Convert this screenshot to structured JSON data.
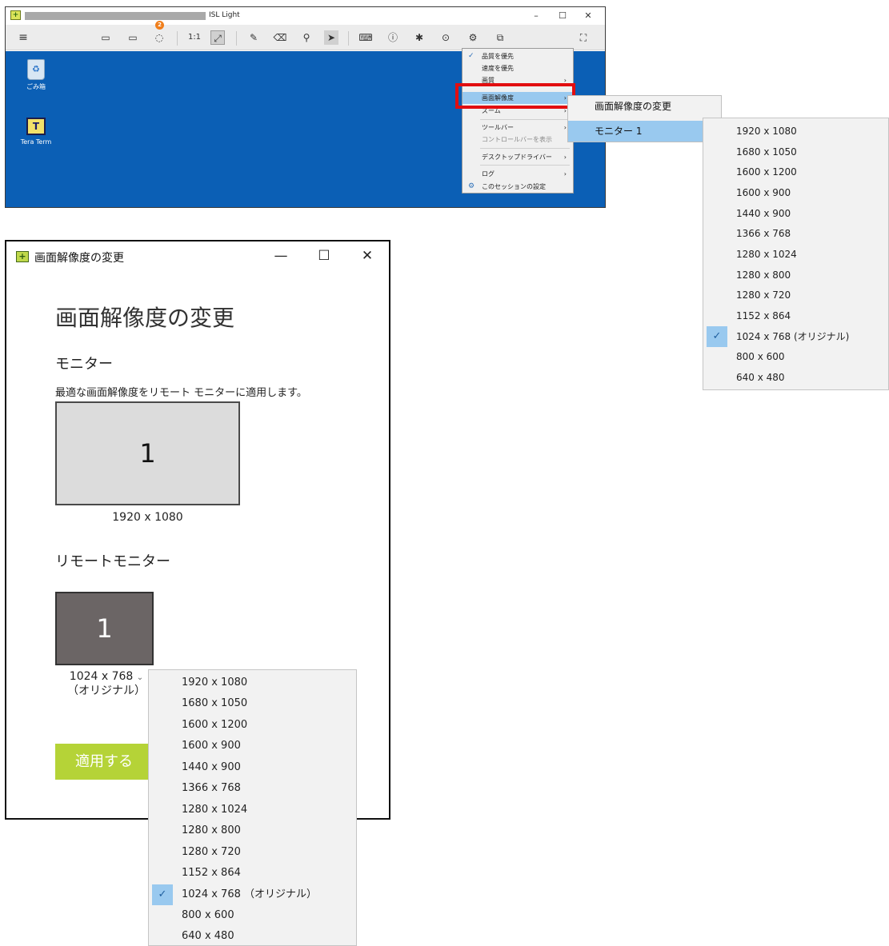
{
  "isl_window": {
    "title": "ISL Light",
    "chat_badge": "2",
    "toolbar": {
      "menu_icon": "≡",
      "monitor_icon": "▭",
      "folder_icon": "▭",
      "chat_icon": "◌",
      "one_to_one": "1:1",
      "fit_icon": "⤢",
      "pen_icon": "✎",
      "eraser_icon": "⌫",
      "pin_icon": "⚲",
      "pointer_icon": "➤",
      "keyboard_icon": "⌨",
      "info_icon": "ⓘ",
      "asterisk_icon": "✱",
      "record_icon": "⊙",
      "gear_icon": "⚙",
      "session_icon": "⧉",
      "fullscreen_icon": "⛶"
    },
    "controls": {
      "minimize": "–",
      "maximize": "☐",
      "close": "✕"
    },
    "desktop_icons": [
      {
        "label": "ごみ箱",
        "glyph": "♻"
      },
      {
        "label": "Tera Term",
        "glyph": "T"
      }
    ],
    "context_menu": {
      "items": [
        {
          "label": "品質を優先",
          "check": "✓"
        },
        {
          "label": "速度を優先"
        },
        {
          "label": "画質",
          "arrow": "›"
        },
        {
          "label": "画面解像度",
          "arrow": "›"
        },
        {
          "label": "ズーム",
          "arrow": "›"
        },
        {
          "label": "ツールバー",
          "arrow": "›"
        },
        {
          "label": "コントロールバーを表示"
        },
        {
          "label": "デスクトップドライバー",
          "arrow": "›"
        },
        {
          "label": "ログ",
          "arrow": "›"
        },
        {
          "label": "このセッションの設定",
          "icon": "⚙"
        }
      ]
    },
    "submenu": {
      "change_resolution": "画面解像度の変更",
      "monitor": "モニター 1"
    }
  },
  "resolutions": [
    "1920 x 1080",
    "1680 x 1050",
    "1600 x 1200",
    "1600 x 900",
    "1440 x 900",
    "1366 x 768",
    "1280 x 1024",
    "1280 x 800",
    "1280 x 720",
    "1152 x 864",
    "1024 x 768 (オリジナル)",
    "800 x 600",
    "640 x 480"
  ],
  "dropdown_resolutions": [
    "1920 x 1080",
    "1680 x 1050",
    "1600 x 1200",
    "1600 x 900",
    "1440 x 900",
    "1366 x 768",
    "1280 x 1024",
    "1280 x 800",
    "1280 x 720",
    "1152 x 864",
    "1024 x 768 （オリジナル）",
    "800 x 600",
    "640 x 480"
  ],
  "selected_check": "✓",
  "dialog": {
    "title": "画面解像度の変更",
    "app_icon": "+",
    "controls": {
      "minimize": "—",
      "maximize": "☐",
      "close": "✕"
    },
    "heading": "画面解像度の変更",
    "monitor_label": "モニター",
    "description": "最適な画面解像度をリモート モニターに適用します。",
    "monitor_number": "1",
    "monitor_resolution": "1920 x 1080",
    "remote_monitor_label": "リモートモニター",
    "remote_monitor_number": "1",
    "remote_resolution": "1024 x 768",
    "remote_resolution_note": "（オリジナル）",
    "chevron": "⌄",
    "apply_button": "適用する"
  }
}
